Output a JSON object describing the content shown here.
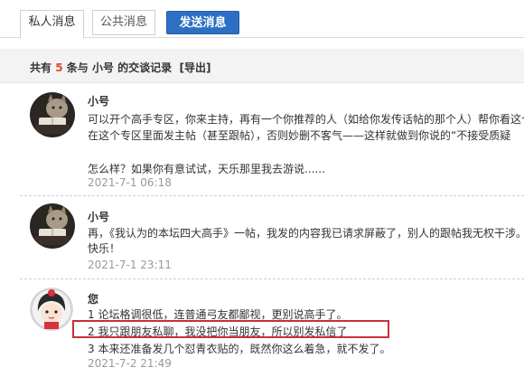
{
  "tabs": {
    "private": "私人消息",
    "public": "公共消息",
    "send": "发送消息"
  },
  "summary": {
    "prefix": "共有",
    "count": "5",
    "middle": "条与",
    "user": "小号",
    "suffix": "的交谈记录",
    "export": "[导出]"
  },
  "messages": [
    {
      "name": "小号",
      "lines": [
        "可以开个高手专区，你来主持，再有一个你推荐的人（如给你发传话帖的那个人）帮你看这个",
        "在这个专区里面发主帖（甚至跟帖），否则妙删不客气——这样就做到你说的“不接受质疑",
        "",
        "怎么样？如果你有意试试，天乐那里我去游说......"
      ],
      "time": "2021-7-1 06:18"
    },
    {
      "name": "小号",
      "lines": [
        "再，《我认为的本坛四大高手》一帖，我发的内容我已请求屏蔽了，别人的跟帖我无权干涉。",
        "快乐！"
      ],
      "time": "2021-7-1 23:11"
    },
    {
      "name": "您",
      "lines": [
        "1 论坛格调很低，连普通弓友都鄙视，更别说高手了。",
        "2 我只跟朋友私聊，我没把你当朋友，所以别发私信了",
        "3 本来还准备发几个怼青衣贴的，既然你这么着急，就不发了。"
      ],
      "time": "2021-7-2 21:49"
    }
  ],
  "colors": {
    "accent": "#2d6fc4",
    "count": "#e04a2a",
    "highlight": "#c8303a",
    "time": "#999999"
  }
}
